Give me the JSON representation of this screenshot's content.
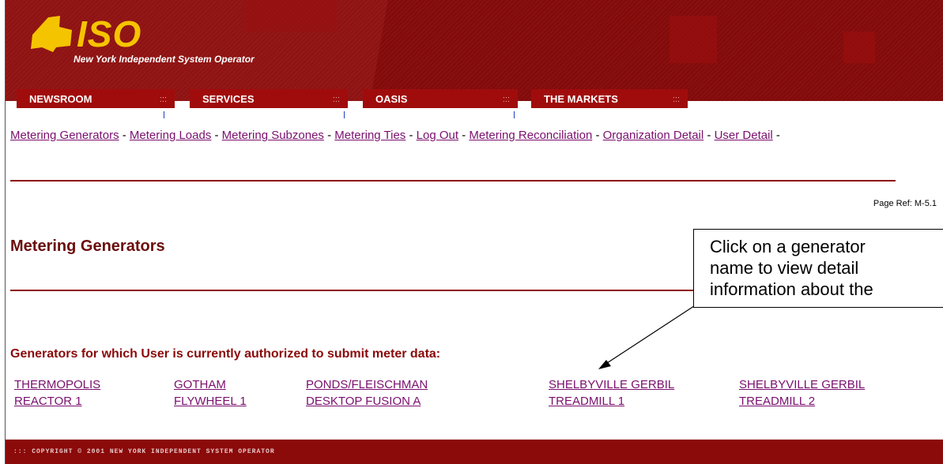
{
  "header": {
    "logo_text": "ISO",
    "subtitle": "New York Independent System Operator"
  },
  "nav": {
    "tabs": [
      {
        "label": "NEWSROOM"
      },
      {
        "label": "SERVICES"
      },
      {
        "label": "OASIS"
      },
      {
        "label": "THE MARKETS"
      }
    ]
  },
  "links": {
    "items": [
      "Metering Generators",
      "Metering Loads",
      "Metering Subzones",
      "Metering Ties",
      "Log Out",
      "Metering Reconciliation",
      "Organization Detail",
      "User Detail"
    ],
    "separator": " - "
  },
  "page": {
    "page_ref": "Page Ref: M-5.1",
    "title": "Metering Generators",
    "subheading": "Generators for which User is currently authorized to submit meter data:"
  },
  "generators": [
    {
      "line1": "THERMOPOLIS",
      "line2": "REACTOR 1"
    },
    {
      "line1": "GOTHAM",
      "line2": "FLYWHEEL 1"
    },
    {
      "line1": "PONDS/FLEISCHMAN",
      "line2": "DESKTOP FUSION A"
    },
    {
      "line1": "SHELBYVILLE GERBIL",
      "line2": "TREADMILL 1"
    },
    {
      "line1": "SHELBYVILLE GERBIL",
      "line2": "TREADMILL 2"
    }
  ],
  "callout": {
    "line1": "Click on a generator",
    "line2": "name to view detail",
    "line3": "information about the"
  },
  "footer": {
    "text": "::: COPYRIGHT © 2001 NEW YORK INDEPENDENT SYSTEM OPERATOR"
  },
  "colors": {
    "brand_red": "#8b0a0a",
    "logo_yellow": "#f5c400",
    "link_purple": "#7a0f6e"
  }
}
